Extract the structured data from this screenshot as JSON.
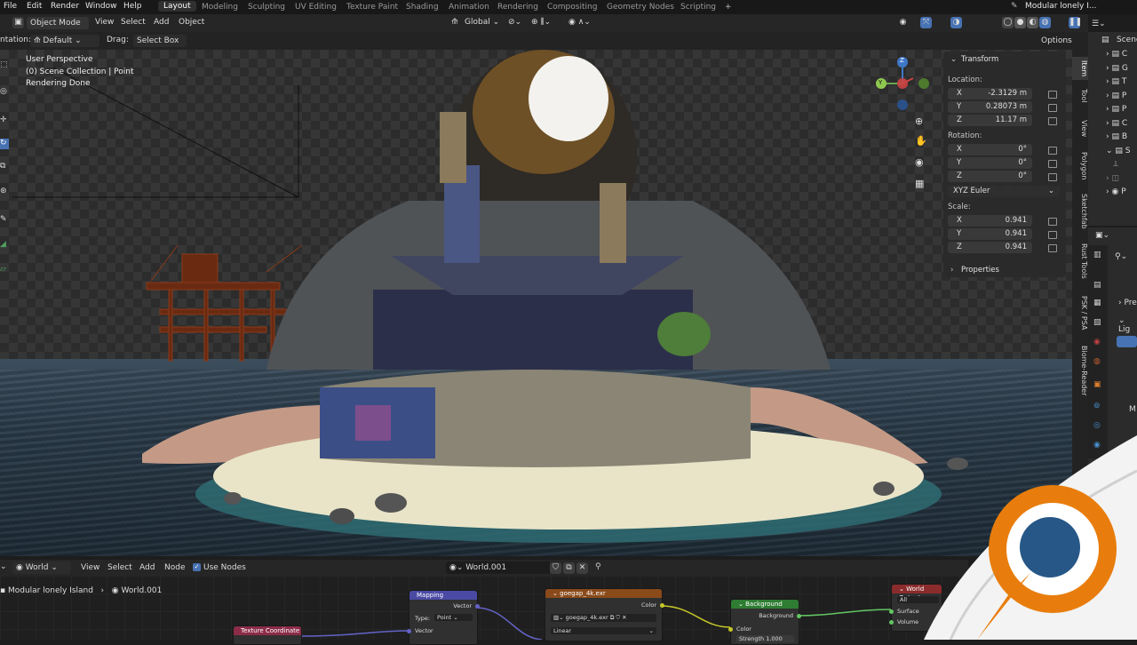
{
  "menu": [
    "File",
    "Edit",
    "Render",
    "Window",
    "Help"
  ],
  "workspaces": [
    "Layout",
    "Modeling",
    "Sculpting",
    "UV Editing",
    "Texture Paint",
    "Shading",
    "Animation",
    "Rendering",
    "Compositing",
    "Geometry Nodes",
    "Scripting"
  ],
  "active_workspace": "Layout",
  "window_title": "Modular lonely I...",
  "header": {
    "mode": "Object Mode",
    "menus": [
      "View",
      "Select",
      "Add",
      "Object"
    ],
    "transform_orientation": "Global",
    "options": "Options"
  },
  "toolbar": {
    "orientation_label": "ntation:",
    "orientation_value": "Default",
    "drag_label": "Drag:",
    "drag_value": "Select Box"
  },
  "viewport": {
    "line1": "User Perspective",
    "line2": "(0) Scene Collection | Point",
    "line3": "Rendering Done"
  },
  "gizmo": {
    "z": "Z",
    "y": "Y"
  },
  "npanel": {
    "transform": "Transform",
    "location": "Location:",
    "loc": [
      {
        "axis": "X",
        "value": "-2.3129 m"
      },
      {
        "axis": "Y",
        "value": "0.28073 m"
      },
      {
        "axis": "Z",
        "value": "11.17 m"
      }
    ],
    "rotation": "Rotation:",
    "rot": [
      {
        "axis": "X",
        "value": "0°"
      },
      {
        "axis": "Y",
        "value": "0°"
      },
      {
        "axis": "Z",
        "value": "0°"
      }
    ],
    "rotation_mode": "XYZ Euler",
    "scale": "Scale:",
    "scl": [
      {
        "axis": "X",
        "value": "0.941"
      },
      {
        "axis": "Y",
        "value": "0.941"
      },
      {
        "axis": "Z",
        "value": "0.941"
      }
    ],
    "properties": "Properties"
  },
  "vtabs": [
    "Item",
    "Tool",
    "View",
    "Polygon",
    "Sketchfab",
    "Rust Tools",
    "PSK / PSA",
    "Biome-Reader"
  ],
  "outliner": {
    "title": "Scene",
    "rows": [
      "C",
      "G",
      "T",
      "P",
      "P",
      "C",
      "B",
      "S",
      "P"
    ]
  },
  "props": {
    "rows": [
      "Pre",
      "Lig"
    ],
    "value": "M"
  },
  "node_header": {
    "world_select": "World",
    "menus": [
      "View",
      "Select",
      "Add",
      "Node"
    ],
    "use_nodes": "Use Nodes",
    "datablock": "World.001"
  },
  "breadcrumb": {
    "scene": "Modular lonely Island",
    "world": "World.001"
  },
  "nodes": {
    "mapping": {
      "title": "Mapping",
      "out": "Vector",
      "type_label": "Type:",
      "type_value": "Point",
      "in": "Vector"
    },
    "texcoord": {
      "title": "Texture Coordinate"
    },
    "image": {
      "title": "goegap_4k.exr",
      "color": "Color",
      "file": "goegap_4k.exr",
      "interp": "Linear"
    },
    "background": {
      "title": "Background",
      "out": "Background",
      "color": "Color",
      "strength": "Strength",
      "strength_val": "1.000"
    },
    "output": {
      "title": "World Output",
      "target": "All",
      "surface": "Surface",
      "volume": "Volume"
    }
  },
  "colors": {
    "accent": "#4772b3",
    "logo_orange": "#e87d0d",
    "logo_blue": "#265787"
  }
}
